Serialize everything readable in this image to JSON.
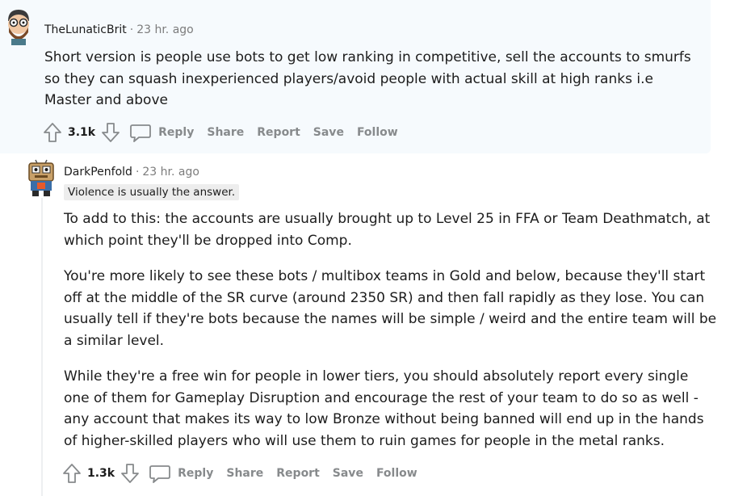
{
  "comments": [
    {
      "author": "TheLunaticBrit",
      "time": "23 hr. ago",
      "body": [
        "Short version is people use bots to get low ranking in competitive, sell the accounts to smurfs so they can squash inexperienced players/avoid people with actual skill at high ranks i.e Master and above"
      ],
      "votes": "3.1k",
      "actions": {
        "reply": "Reply",
        "share": "Share",
        "report": "Report",
        "save": "Save",
        "follow": "Follow"
      }
    },
    {
      "author": "DarkPenfold",
      "time": "23 hr. ago",
      "flair": "Violence is usually the answer.",
      "body": [
        "To add to this: the accounts are usually brought up to Level 25 in FFA or Team Deathmatch, at which point they'll be dropped into Comp.",
        "You're more likely to see these bots / multibox teams in Gold and below, because they'll start off at the middle of the SR curve (around 2350 SR) and then fall rapidly as they lose. You can usually tell if they're bots because the names will be simple / weird and the entire team will be a similar level.",
        "While they're a free win for people in lower tiers, you should absolutely report every single one of them for Gameplay Disruption and encourage the rest of your team to do so as well - any account that makes its way to low Bronze without being banned will end up in the hands of higher-skilled players who will use them to ruin games for people in the metal ranks."
      ],
      "votes": "1.3k",
      "actions": {
        "reply": "Reply",
        "share": "Share",
        "report": "Report",
        "save": "Save",
        "follow": "Follow"
      }
    }
  ],
  "icons": [
    "upvote-icon",
    "downvote-icon",
    "comment-icon"
  ]
}
